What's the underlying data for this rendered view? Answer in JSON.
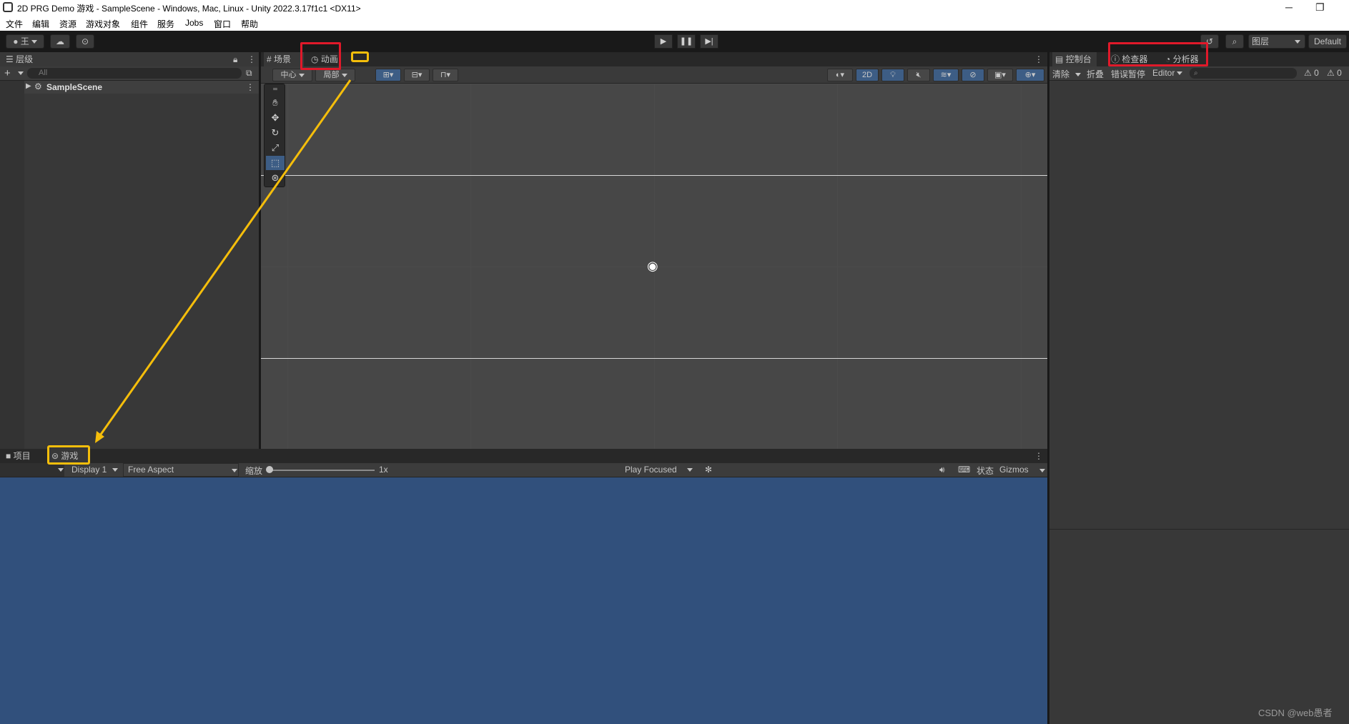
{
  "window": {
    "title": "2D PRG Demo 游戏 - SampleScene - Windows, Mac, Linux - Unity 2022.3.17f1c1 <DX11>",
    "minimize": "─",
    "restore": "❐"
  },
  "menu": [
    "文件",
    "编辑",
    "资源",
    "游戏对象",
    "组件",
    "服务",
    "Jobs",
    "窗口",
    "帮助"
  ],
  "toolbar": {
    "account_label": "王",
    "layers_label": "图层",
    "layout_label": "Default"
  },
  "hierarchy": {
    "tab_label": "层级",
    "search_placeholder": "All",
    "scene_name": "SampleScene"
  },
  "scene_view": {
    "tabs": [
      "场景",
      "动画"
    ],
    "pivot_label": "中心",
    "space_label": "局部",
    "mode_2d_label": "2D"
  },
  "console": {
    "tabs": [
      "控制台",
      "检查器",
      "分析器"
    ],
    "clear_label": "清除",
    "collapse_label": "折叠",
    "error_pause_label": "错误暂停",
    "editor_label": "Editor",
    "warn_count": "0",
    "error_count": "0"
  },
  "bottom": {
    "tabs": [
      "项目",
      "游戏"
    ],
    "display_label": "Display 1",
    "aspect_label": "Free Aspect",
    "scale_label": "缩放",
    "scale_value": "1x",
    "play_mode_label": "Play Focused",
    "stats_label": "状态",
    "gizmos_label": "Gizmos"
  },
  "game_view_color": "#31507c",
  "watermark": "CSDN @web愚者",
  "colors": {
    "annotation_red": "#e0192a",
    "annotation_yellow": "#f5be0b"
  }
}
